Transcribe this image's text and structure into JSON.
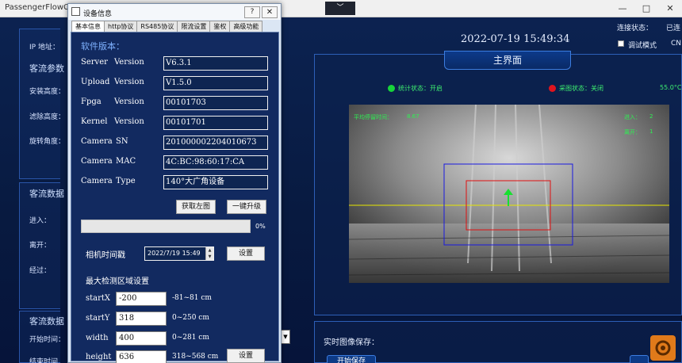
{
  "app": {
    "title": "PassengerFlowCl",
    "window_buttons": [
      "—",
      "□",
      "✕"
    ],
    "dropdown_glyph": "﹀",
    "connection_label": "连接状态：",
    "connection_value": "已连",
    "debug_mode_label": "调试模式",
    "language": "CN",
    "datetime": "2022-07-19 15:49:34",
    "main_tab": "主界面",
    "left_panel": {
      "ip_label": "IP 地址：",
      "section1_title": "客流参数",
      "install_height": "安装高度：",
      "filter_height": "滤除高度：",
      "rotate_angle": "旋转角度：",
      "section2_title": "客流数据",
      "in_label": "进入：",
      "out_label": "离开：",
      "pass_label": "经过：",
      "section3_title": "客流数据",
      "start_time": "开始时间：",
      "end_time": "结束时间"
    },
    "status": {
      "stat_label": "统计状态：开启",
      "capture_label": "采图状态：关闭",
      "temperature": "55.0°C"
    },
    "camera": {
      "avg_stay_label": "平均停留时间：",
      "avg_stay_value": "8.67",
      "in_label": "进入：",
      "in_value": "2",
      "out_label": "离开：",
      "out_value": "1"
    },
    "save": {
      "label": "实时图像保存：",
      "start_button": "开始保存"
    },
    "colors": {
      "ok": "#17d43a",
      "alert": "#e0141e",
      "accent": "#3c7de0"
    }
  },
  "dialog": {
    "title": "设备信息",
    "help": "?",
    "close": "✕",
    "tabs": [
      "基本信息",
      "http协议",
      "RS485协议",
      "限流设置",
      "鉴权",
      "高级功能"
    ],
    "software_title": "软件版本：",
    "versions": [
      {
        "label_a": "Server",
        "label_b": "Version",
        "value": "V6.3.1"
      },
      {
        "label_a": "Upload",
        "label_b": "Version",
        "value": "V1.5.0"
      },
      {
        "label_a": "Fpga",
        "label_b": "Version",
        "value": "00101703"
      },
      {
        "label_a": "Kernel",
        "label_b": "Version",
        "value": "00101701"
      },
      {
        "label_a": "Camera",
        "label_b": "SN",
        "value": "201000002204010673"
      },
      {
        "label_a": "Camera",
        "label_b": "MAC",
        "value": "4C:BC:98:60:17:CA"
      },
      {
        "label_a": "Camera",
        "label_b": "Type",
        "value": "140°大广角设备"
      }
    ],
    "get_left_image": "获取左图",
    "one_click_upgrade": "一键升级",
    "progress_percent": "0%",
    "progress_fraction": 0,
    "camera_time_label": "相机时间戳",
    "camera_time_value": "2022/7/19 15:49",
    "set_button": "设置",
    "region_title": "最大检测区域设置",
    "region": [
      {
        "label": "startX",
        "value": "-200",
        "range": "-81~81 cm"
      },
      {
        "label": "startY",
        "value": "318",
        "range": "0~250 cm"
      },
      {
        "label": "width",
        "value": "400",
        "range": "0~281 cm"
      },
      {
        "label": "height",
        "value": "636",
        "range": "318~568 cm"
      }
    ],
    "region_set_button": "设置"
  }
}
